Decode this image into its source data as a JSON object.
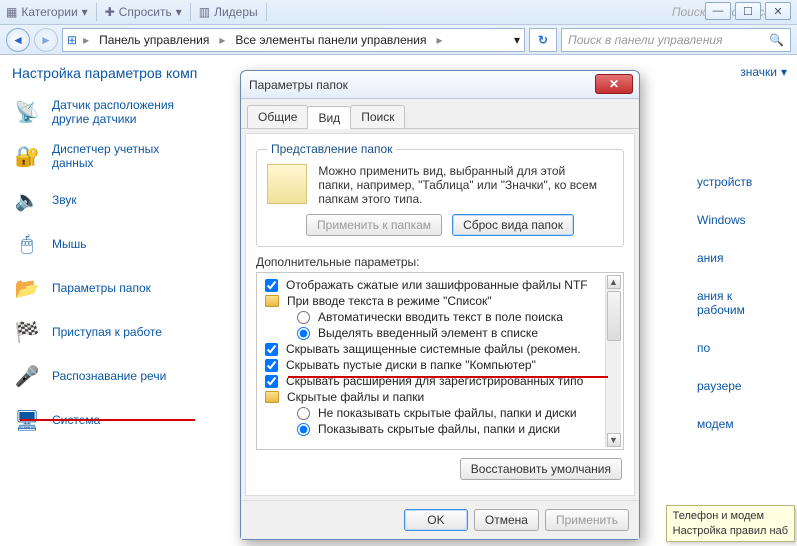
{
  "ribbon": {
    "group1": "Категории",
    "group2": "Спросить",
    "group3": "Лидеры",
    "search_placeholder": "Поиск по вопросам…"
  },
  "window_buttons": {
    "min": "—",
    "max": "☐",
    "close": "✕"
  },
  "breadcrumb": {
    "root_icon": "⊞",
    "parts": [
      "Панель управления",
      "Все элементы панели управления"
    ],
    "dropdown": "▾",
    "refresh": "↻",
    "search_placeholder": "Поиск в панели управления",
    "search_icon": "🔍"
  },
  "page": {
    "title": "Настройка параметров комп",
    "view_label": "значки",
    "view_arrow": "▾"
  },
  "items": [
    "Датчик расположения\nдругие датчики",
    "Диспетчер учетных\nданных",
    "Звук",
    "Мышь",
    "Параметры папок",
    "Приступая к работе",
    "Распознавание речи",
    "Система"
  ],
  "item_icons": [
    "📡",
    "🔐",
    "🔈",
    "🖱",
    "📂",
    "🏁",
    "🎤",
    "🖥"
  ],
  "right_items": [
    "устройств",
    "Windows",
    "ания",
    "ания к\nрабочим",
    "по",
    "раузере",
    "модем"
  ],
  "dialog": {
    "title": "Параметры папок",
    "close": "✕",
    "tabs": [
      "Общие",
      "Вид",
      "Поиск"
    ],
    "active_tab": 1,
    "folder_views": {
      "legend": "Представление папок",
      "text": "Можно применить вид, выбранный для этой папки, например, \"Таблица\" или \"Значки\", ко всем папкам этого типа.",
      "apply_btn": "Применить к папкам",
      "reset_btn": "Сброс вида папок"
    },
    "advanced_label": "Дополнительные параметры:",
    "tree": [
      {
        "type": "check",
        "checked": true,
        "ind": 0,
        "text": "Отображать сжатые или зашифрованные файлы NTF"
      },
      {
        "type": "folder",
        "ind": 0,
        "text": "При вводе текста в режиме \"Список\""
      },
      {
        "type": "radio",
        "checked": false,
        "ind": 2,
        "text": "Автоматически вводить текст в поле поиска"
      },
      {
        "type": "radio",
        "checked": true,
        "ind": 2,
        "text": "Выделять введенный элемент в списке"
      },
      {
        "type": "check",
        "checked": true,
        "ind": 0,
        "text": "Скрывать защищенные системные файлы (рекомен."
      },
      {
        "type": "check",
        "checked": true,
        "ind": 0,
        "text": "Скрывать пустые диски в папке \"Компьютер\""
      },
      {
        "type": "check",
        "checked": true,
        "ind": 0,
        "text": "Скрывать расширения для зарегистрированных типо"
      },
      {
        "type": "folder",
        "ind": 0,
        "text": "Скрытые файлы и папки"
      },
      {
        "type": "radio",
        "checked": false,
        "ind": 2,
        "text": "Не показывать скрытые файлы, папки и диски"
      },
      {
        "type": "radio",
        "checked": true,
        "ind": 2,
        "text": "Показывать скрытые файлы, папки и диски"
      }
    ],
    "restore_btn": "Восстановить умолчания",
    "ok": "OK",
    "cancel": "Отмена",
    "apply": "Применить"
  },
  "tooltip": {
    "line1": "Телефон и модем",
    "line2": "Настройка правил наб"
  }
}
